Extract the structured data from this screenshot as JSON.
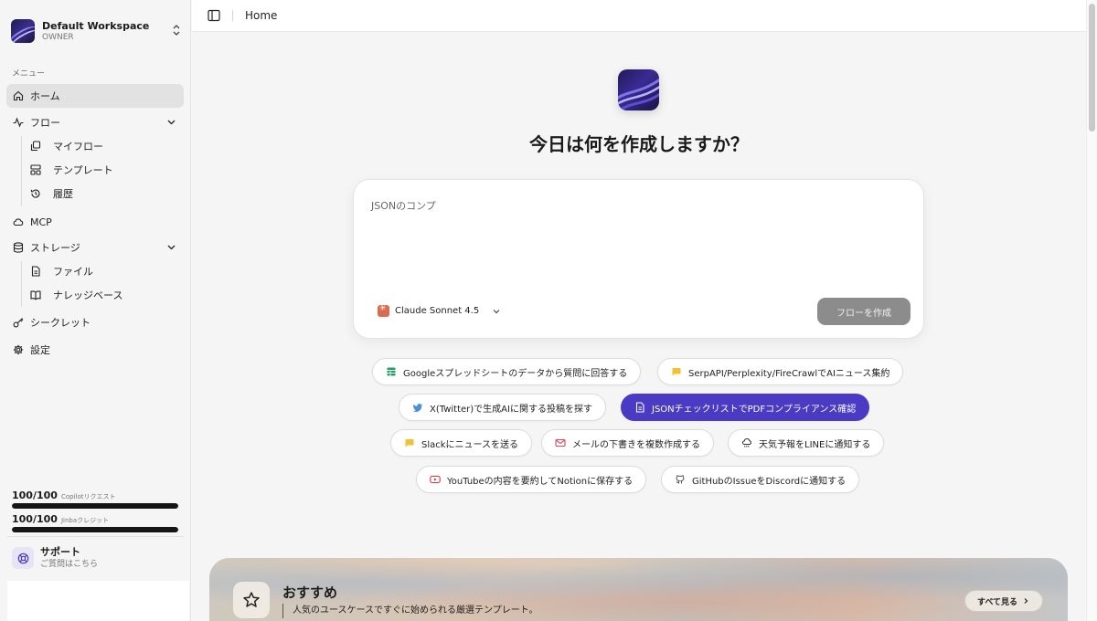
{
  "workspace": {
    "name": "Default Workspace",
    "role": "OWNER"
  },
  "sidebar": {
    "menu_label": "メニュー",
    "items": [
      {
        "label": "ホーム",
        "icon": "home-icon",
        "active": true
      },
      {
        "label": "フロー",
        "icon": "activity-icon"
      },
      {
        "label": "マイフロー",
        "icon": "copy-icon"
      },
      {
        "label": "テンプレート",
        "icon": "template-icon"
      },
      {
        "label": "履歴",
        "icon": "history-icon"
      },
      {
        "label": "MCP",
        "icon": "cloud-icon"
      },
      {
        "label": "ストレージ",
        "icon": "database-icon"
      },
      {
        "label": "ファイル",
        "icon": "file-icon"
      },
      {
        "label": "ナレッジベース",
        "icon": "book-icon"
      },
      {
        "label": "シークレット",
        "icon": "key-icon"
      },
      {
        "label": "設定",
        "icon": "gear-icon"
      }
    ],
    "credits": [
      {
        "value": "100/100",
        "label": "Copilotリクエスト",
        "fraction": 1.0
      },
      {
        "value": "100/100",
        "label": "Jinbaクレジット",
        "fraction": 1.0
      }
    ],
    "support": {
      "title": "サポート",
      "subtitle": "ご質問はこちら"
    }
  },
  "topbar": {
    "breadcrumb": "Home"
  },
  "main": {
    "headline": "今日は何を作成しますか？",
    "prompt_text": "JSONのコンプ",
    "model": "Claude Sonnet 4.5",
    "create_button": "フローを作成",
    "suggestions": [
      {
        "label": "Googleスプレッドシートのデータから質問に回答する",
        "icon": "sheets-icon"
      },
      {
        "label": "SerpAPI/Perplexity/FireCrawlでAIニュース集約",
        "icon": "message-icon"
      },
      {
        "label": "X(Twitter)で生成AIに関する投稿を探す",
        "icon": "twitter-icon"
      },
      {
        "label": "JSONチェックリストでPDFコンプライアンス確認",
        "icon": "document-icon",
        "active": true
      },
      {
        "label": "Slackにニュースを送る",
        "icon": "message-icon"
      },
      {
        "label": "メールの下書きを複数作成する",
        "icon": "mail-icon"
      },
      {
        "label": "天気予報をLINEに通知する",
        "icon": "cloud-rain-icon"
      },
      {
        "label": "YouTubeの内容を要約してNotionに保存する",
        "icon": "youtube-icon"
      },
      {
        "label": "GitHubのIssueをDiscordに通知する",
        "icon": "github-icon"
      }
    ],
    "recommended": {
      "title": "おすすめ",
      "subtitle": "人気のユースケースですぐに始められる厳選テンプレート。",
      "view_all": "すべて見る"
    }
  },
  "colors": {
    "accent": "#4a3ac4",
    "disabled_button": "#8c8c8c",
    "model_icon": "#d96c4e"
  }
}
